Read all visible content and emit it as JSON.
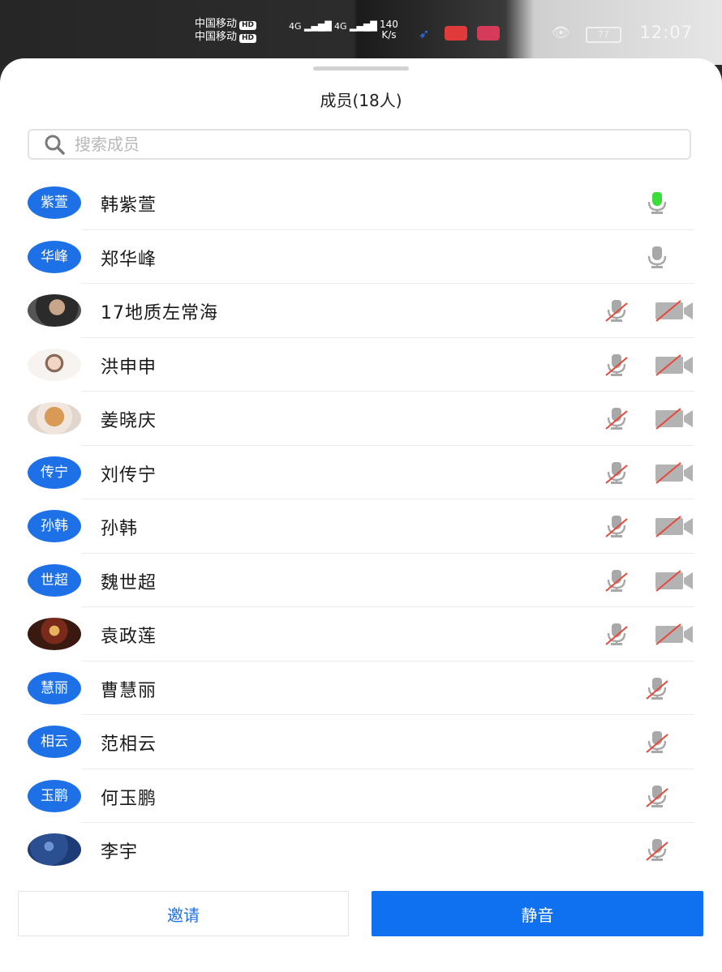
{
  "status_bar": {
    "carrier_1": "中国移动",
    "carrier_2": "中国移动",
    "hd_badge": "HD",
    "net_1": "4G",
    "net_2": "4G",
    "speed_value": "140",
    "speed_unit": "K/s",
    "battery": "77",
    "time": "12:07"
  },
  "sheet": {
    "title": "成员(18人)",
    "search_placeholder": "搜索成员"
  },
  "members": [
    {
      "name": "韩紫萱",
      "avatar_text": "紫萱",
      "avatar_type": "text",
      "mic": "active",
      "camera": false
    },
    {
      "name": "郑华峰",
      "avatar_text": "华峰",
      "avatar_type": "text",
      "mic": "on",
      "camera": false
    },
    {
      "name": "17地质左常海",
      "avatar_text": "",
      "avatar_type": "photo",
      "mic": "off",
      "camera": "off"
    },
    {
      "name": "洪申申",
      "avatar_text": "",
      "avatar_type": "photo",
      "mic": "off",
      "camera": "off"
    },
    {
      "name": "姜晓庆",
      "avatar_text": "",
      "avatar_type": "photo",
      "mic": "off",
      "camera": "off"
    },
    {
      "name": "刘传宁",
      "avatar_text": "传宁",
      "avatar_type": "text",
      "mic": "off",
      "camera": "off"
    },
    {
      "name": "孙韩",
      "avatar_text": "孙韩",
      "avatar_type": "text",
      "mic": "off",
      "camera": "off"
    },
    {
      "name": "魏世超",
      "avatar_text": "世超",
      "avatar_type": "text",
      "mic": "off",
      "camera": "off"
    },
    {
      "name": "袁政莲",
      "avatar_text": "",
      "avatar_type": "photo",
      "mic": "off",
      "camera": "off"
    },
    {
      "name": "曹慧丽",
      "avatar_text": "慧丽",
      "avatar_type": "text",
      "mic": "off",
      "camera": false
    },
    {
      "name": "范相云",
      "avatar_text": "相云",
      "avatar_type": "text",
      "mic": "off",
      "camera": false
    },
    {
      "name": "何玉鹏",
      "avatar_text": "玉鹏",
      "avatar_type": "text",
      "mic": "off",
      "camera": false
    },
    {
      "name": "李宇",
      "avatar_text": "",
      "avatar_type": "photo",
      "mic": "off",
      "camera": false
    }
  ],
  "footer": {
    "invite_label": "邀请",
    "mute_label": "静音"
  },
  "colors": {
    "accent": "#1e70e6",
    "mic_active": "#3ddc3d",
    "icon_gray": "#b5b5b5",
    "mute_slash": "#e8483a"
  },
  "icons": [
    "search-icon",
    "microphone-icon",
    "microphone-muted-icon",
    "camera-off-icon",
    "eye-icon",
    "battery-icon"
  ]
}
